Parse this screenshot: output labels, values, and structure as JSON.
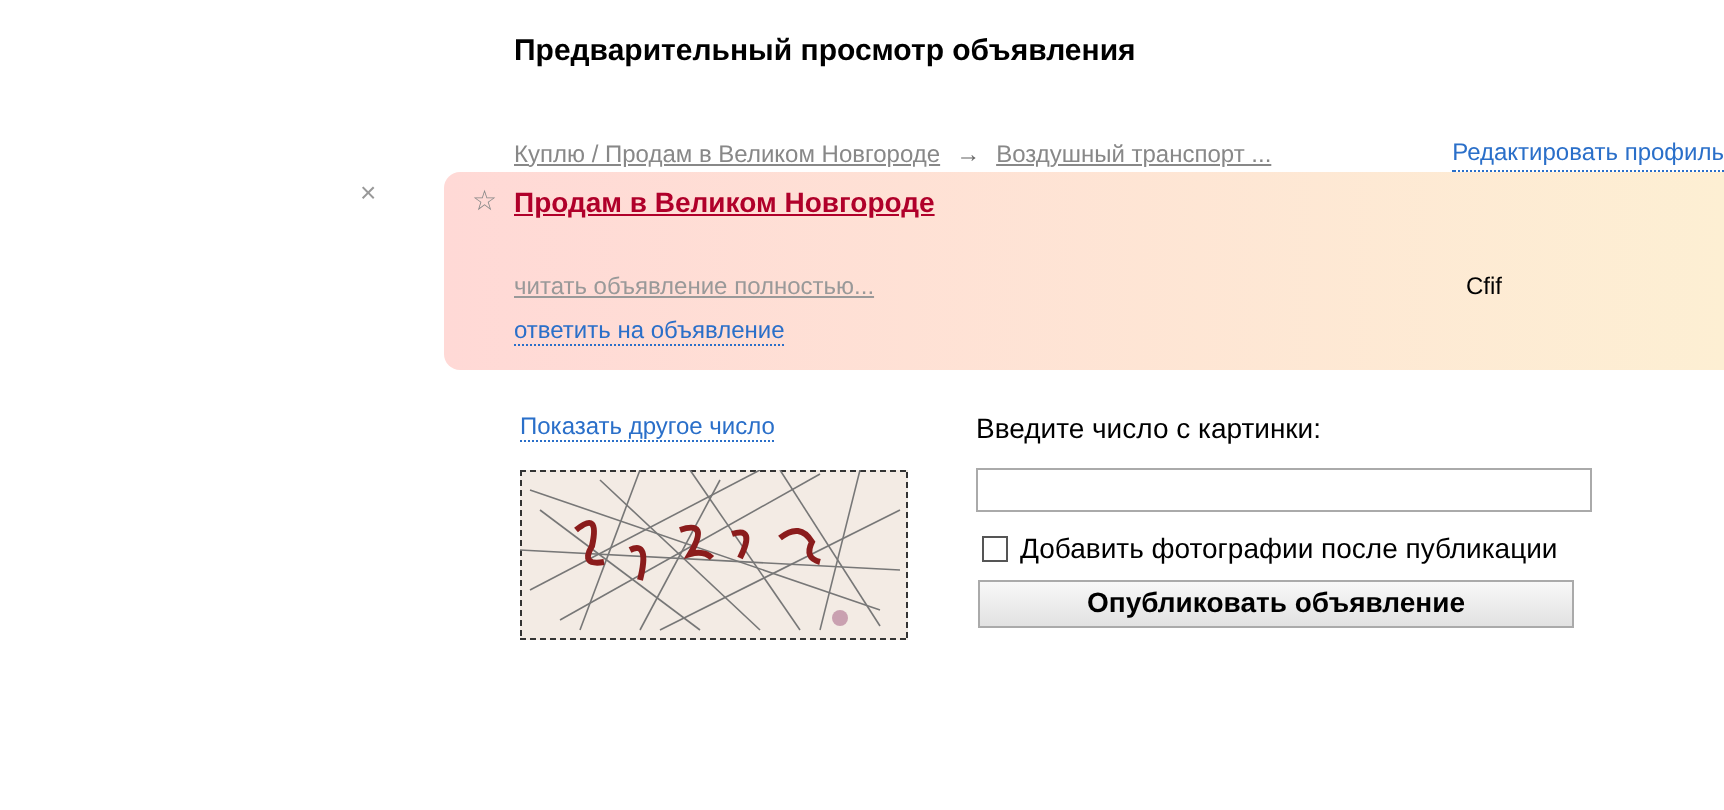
{
  "page_title": "Предварительный просмотр объявления",
  "breadcrumb": [
    {
      "label": "Куплю / Продам в Великом Новгороде"
    },
    {
      "label": "Воздушный транспорт ..."
    }
  ],
  "breadcrumb_separator": "→",
  "edit_profile_link": "Редактировать профиль",
  "ad": {
    "close": "×",
    "star": "☆",
    "title": "Продам в Великом Новгороде",
    "read_more": "читать объявление полностью...",
    "reply": "ответить на объявление",
    "author": "Cfif"
  },
  "captcha": {
    "refresh_link": "Показать другое число",
    "label": "Введите число с картинки:"
  },
  "photos_checkbox": {
    "label": "Добавить фотографии после публикации",
    "checked": false
  },
  "publish_button": "Опубликовать объявление"
}
